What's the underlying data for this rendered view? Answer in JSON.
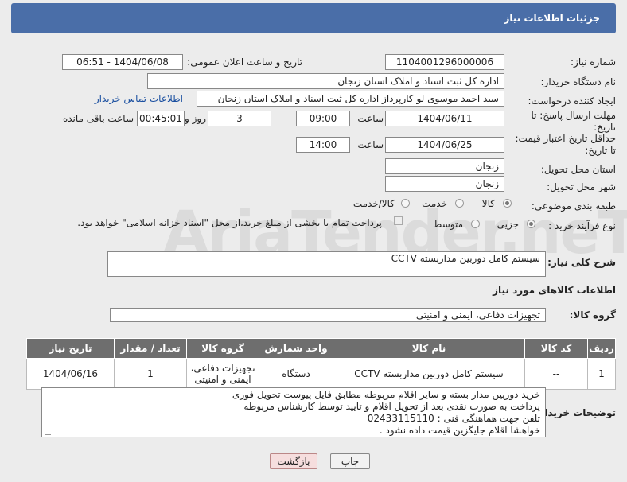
{
  "header": {
    "title": "جزئیات اطلاعات نیاز"
  },
  "watermark": {
    "text": "AriaTender.neT"
  },
  "fields": {
    "need_number_label": "شماره نیاز:",
    "need_number": "1104001296000006",
    "announce_label": "تاریخ و ساعت اعلان عمومی:",
    "announce_value": "1404/06/08 - 06:51",
    "buyer_org_label": "نام دستگاه خریدار:",
    "buyer_org": "اداره کل ثبت اسناد و املاک استان زنجان",
    "requester_label": "ایجاد کننده درخواست:",
    "requester": "سید احمد موسوی لو کارپرداز اداره کل ثبت اسناد و املاک استان زنجان",
    "contact_link": "اطلاعات تماس خریدار",
    "deadline_label_1": "مهلت ارسال پاسخ: تا",
    "deadline_label_2": "تاریخ:",
    "deadline_date": "1404/06/11",
    "time_label": "ساعت",
    "deadline_time": "09:00",
    "days_value": "3",
    "days_label": "روز و",
    "remaining_value": "00:45:01",
    "remaining_label": "ساعت باقی مانده",
    "validity_label_1": "حداقل تاریخ اعتبار قیمت:",
    "validity_label_2": "تا تاریخ:",
    "validity_date": "1404/06/25",
    "validity_time": "14:00",
    "province_label": "استان محل تحویل:",
    "province": "زنجان",
    "city_label": "شهر محل تحویل:",
    "city": "زنجان",
    "category_label": "طبقه بندی موضوعی:",
    "category_options": [
      "کالا",
      "خدمت",
      "کالا/خدمت"
    ],
    "process_label": "نوع فرآیند خرید :",
    "process_options": [
      "جزیی",
      "متوسط"
    ],
    "payment_note": "پرداخت تمام یا بخشی از مبلغ خرید،از محل \"اسناد خزانه اسلامی\" خواهد بود."
  },
  "summary": {
    "label": "شرح کلی نیاز:",
    "value": "سیستم کامل دوربین مداربسته CCTV"
  },
  "goods_section": {
    "title": "اطلاعات کالاهای مورد نیاز",
    "group_label": "گروه کالا:",
    "group_value": "تجهیزات دفاعی، ایمنی و امنیتی"
  },
  "table": {
    "headers": [
      "ردیف",
      "کد کالا",
      "نام کالا",
      "واحد شمارش",
      "گروه کالا",
      "تعداد / مقدار",
      "تاریخ نیاز"
    ],
    "rows": [
      [
        "1",
        "--",
        "سیستم کامل دوربین مداربسته CCTV",
        "دستگاه",
        "تجهیزات دفاعی، ایمنی و امنیتی",
        "1",
        "1404/06/16"
      ]
    ]
  },
  "buyer_notes": {
    "label": "توضیحات خریدار:",
    "lines": [
      "خرید دوربین مدار بسته و سایر اقلام مربوطه مطابق فایل پیوست تحویل فوری",
      "پرداخت به صورت نقدی بعد از تحویل اقلام و تایید توسط کارشناس مربوطه",
      "تلفن جهت هماهنگی فنی : 02433115110",
      "خواهشا اقلام جایگزین قیمت داده نشود ."
    ]
  },
  "buttons": {
    "print": "چاپ",
    "back": "بازگشت"
  }
}
